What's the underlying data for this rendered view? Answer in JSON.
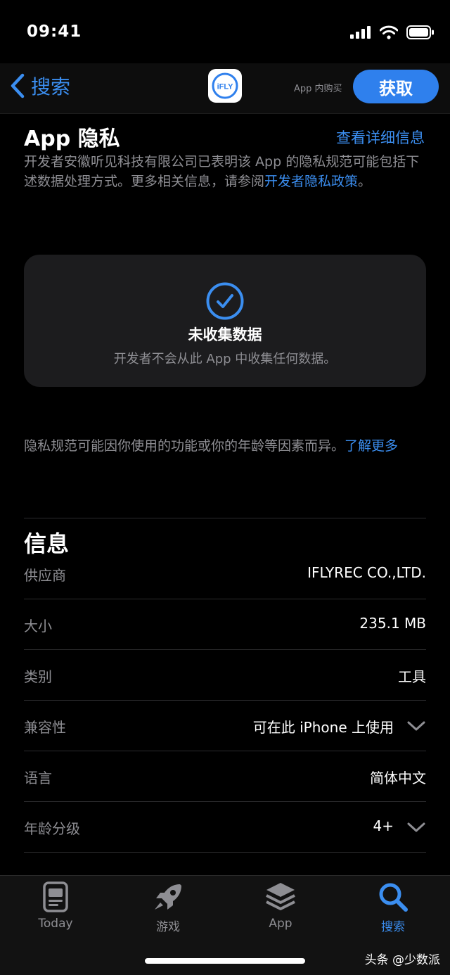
{
  "status": {
    "time": "09:41"
  },
  "nav": {
    "back_label": "搜索",
    "app_icon_text": "iFLY",
    "iap_note": "App 内购买",
    "get_label": "获取"
  },
  "privacy": {
    "title": "App 隐私",
    "see_details": "查看详细信息",
    "desc_text": "开发者安徽听见科技有限公司已表明该 App 的隐私规范可能包括下述数据处理方式。更多相关信息，请参阅",
    "desc_link": "开发者隐私政策",
    "desc_end": "。",
    "card_title": "未收集数据",
    "card_sub": "开发者不会从此 App 中收集任何数据。",
    "note_text": "隐私规范可能因你使用的功能或你的年龄等因素而异。",
    "note_link": "了解更多"
  },
  "info": {
    "title": "信息",
    "rows": [
      {
        "label": "供应商",
        "value": "IFLYREC CO.,LTD."
      },
      {
        "label": "大小",
        "value": "235.1 MB"
      },
      {
        "label": "类别",
        "value": "工具"
      },
      {
        "label": "兼容性",
        "value": "可在此 iPhone 上使用"
      },
      {
        "label": "语言",
        "value": "简体中文"
      },
      {
        "label": "年龄分级",
        "value": "4+"
      }
    ]
  },
  "tabbar": {
    "tabs": [
      {
        "label": "Today",
        "icon": "today-icon"
      },
      {
        "label": "游戏",
        "icon": "rocket-icon"
      },
      {
        "label": "App",
        "icon": "app-stack-icon"
      },
      {
        "label": "搜索",
        "icon": "search-icon",
        "active": true
      }
    ]
  },
  "watermark": "头条 @少数派",
  "colors": {
    "accent": "#3b8ef0",
    "background": "#000000",
    "card": "#1c1c1e",
    "secondary_text": "#8e8e93"
  }
}
